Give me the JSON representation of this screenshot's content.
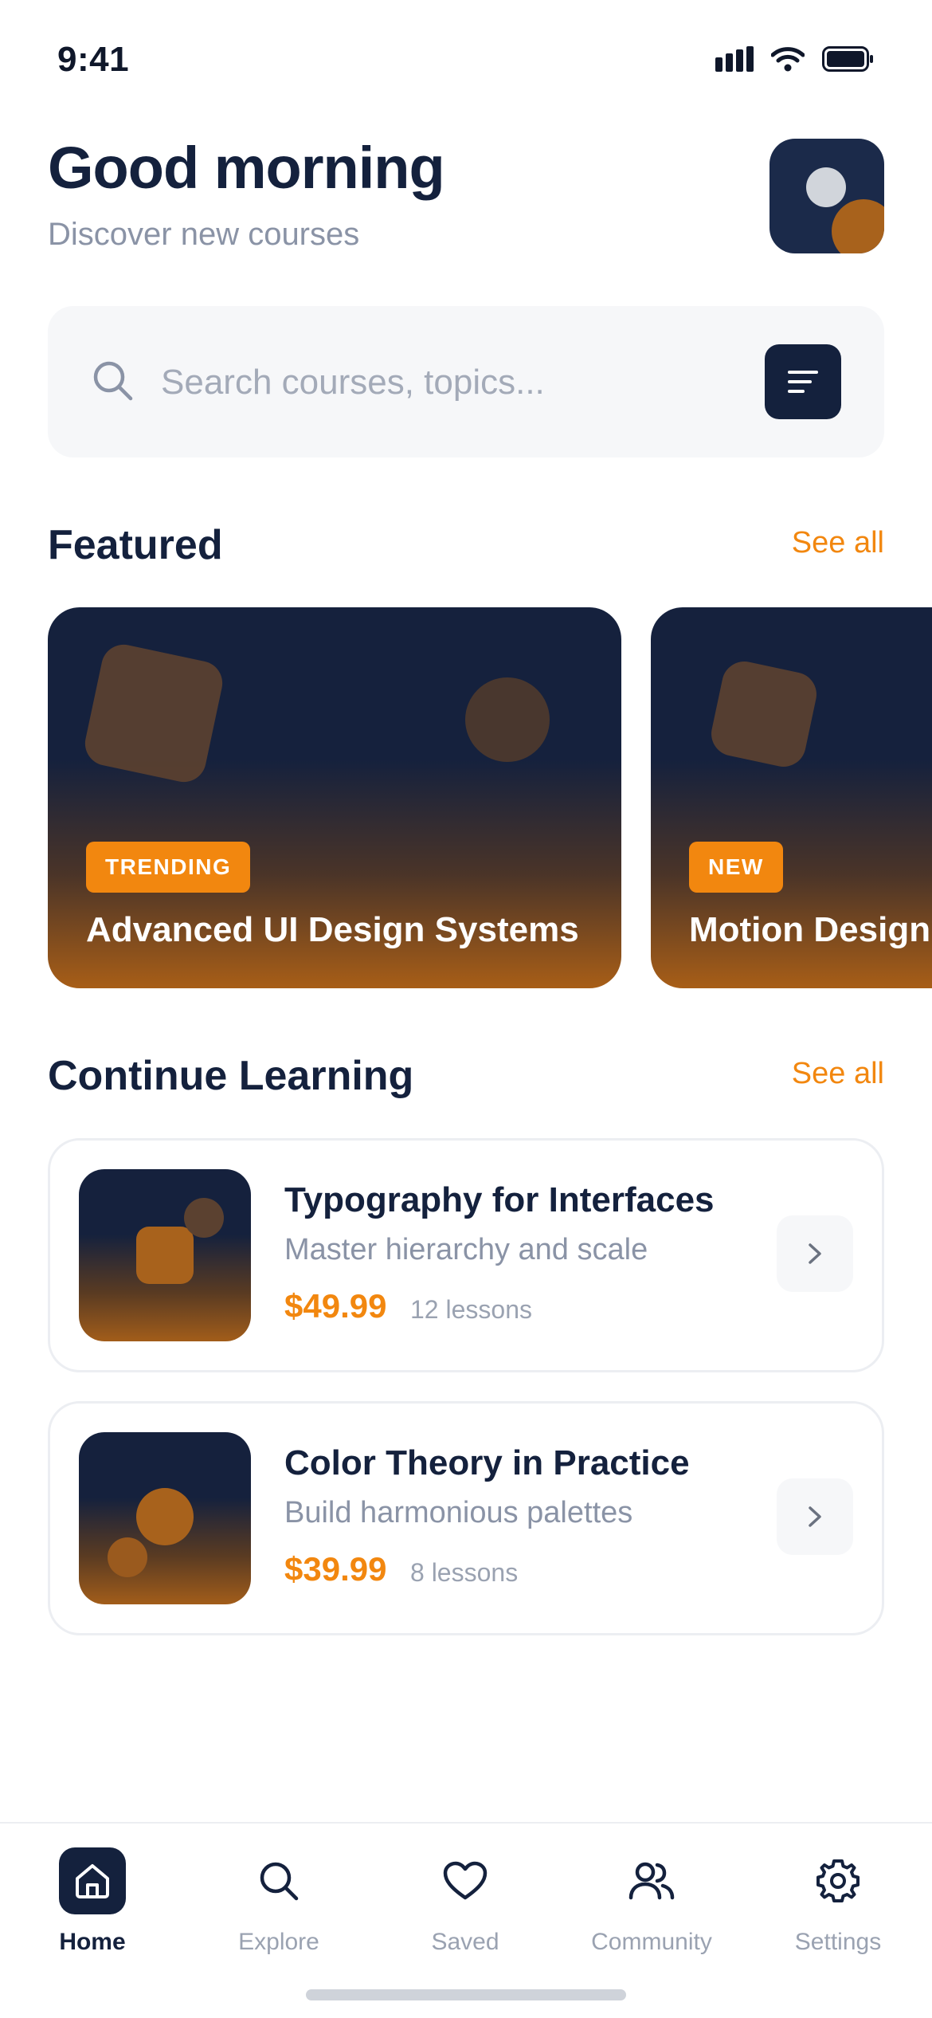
{
  "status_bar": {
    "time": "9:41"
  },
  "header": {
    "greeting": "Good morning",
    "subtitle": "Discover new courses"
  },
  "search": {
    "placeholder": "Search courses, topics..."
  },
  "featured": {
    "title": "Featured",
    "see_all": "See all",
    "cards": [
      {
        "badge": "TRENDING",
        "title": "Advanced UI Design Systems"
      },
      {
        "badge": "NEW",
        "title": "Motion Design"
      }
    ]
  },
  "continue_learning": {
    "title": "Continue Learning",
    "see_all": "See all",
    "courses": [
      {
        "title": "Typography for Interfaces",
        "subtitle": "Master hierarchy and scale",
        "price": "$49.99",
        "lessons": "12 lessons"
      },
      {
        "title": "Color Theory in Practice",
        "subtitle": "Build harmonious palettes",
        "price": "$39.99",
        "lessons": "8 lessons"
      }
    ]
  },
  "bottom_nav": {
    "items": [
      {
        "label": "Home",
        "icon": "home-icon",
        "active": true
      },
      {
        "label": "Explore",
        "icon": "search-icon",
        "active": false
      },
      {
        "label": "Saved",
        "icon": "heart-icon",
        "active": false
      },
      {
        "label": "Community",
        "icon": "users-icon",
        "active": false
      },
      {
        "label": "Settings",
        "icon": "gear-icon",
        "active": false
      }
    ]
  },
  "colors": {
    "navy": "#14213d",
    "accent": "#f2870f",
    "muted": "#8a93a6"
  }
}
